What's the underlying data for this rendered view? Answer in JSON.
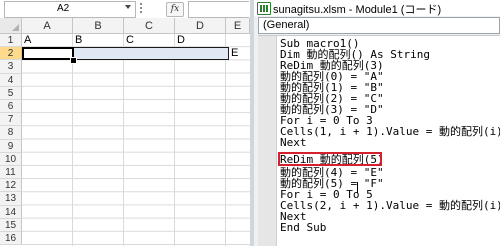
{
  "excel": {
    "name_box": "A2",
    "fx_label": "fx",
    "columns": [
      "A",
      "B",
      "C",
      "D",
      "E"
    ],
    "rows": [
      "1",
      "2",
      "3",
      "4",
      "5",
      "6",
      "7",
      "8",
      "9",
      "10",
      "11",
      "12",
      "13",
      "14",
      "15",
      "16"
    ],
    "selected_row": "2",
    "cells_row1": [
      "A",
      "B",
      "C",
      "D"
    ],
    "overflow_row2": "E"
  },
  "vbe": {
    "title": "sunagitsu.xlsm - Module1 (コード)",
    "procedure_combo": "(General)",
    "code_lines": [
      "Sub macro1()",
      "Dim 動的配列() As String",
      "ReDim 動的配列(3)",
      "動的配列(0) = \"A\"",
      "動的配列(1) = \"B\"",
      "動的配列(2) = \"C\"",
      "動的配列(3) = \"D\"",
      "For i = 0 To 3",
      "Cells(1, i + 1).Value = 動的配列(i)",
      "Next",
      "",
      "ReDim 動的配列(5)",
      "動的配列(4) = \"E\"",
      "動的配列(5) = \"F\"",
      "For i = 0 To 5",
      "Cells(2, i + 1).Value = 動的配列(i)",
      "Next",
      "End Sub"
    ]
  },
  "colors": {
    "highlight_box": "#d3212d",
    "selected_header": "#ffd98c",
    "row_selection": "#dfe8f3"
  }
}
